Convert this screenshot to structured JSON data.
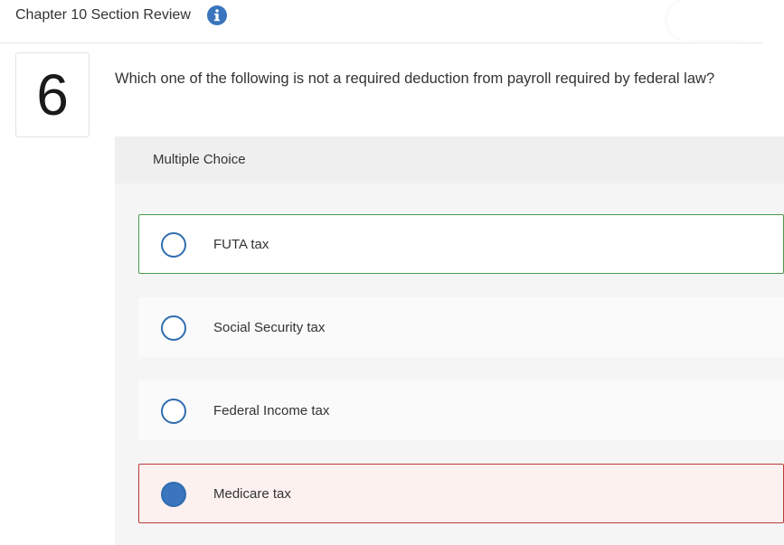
{
  "header": {
    "title": "Chapter 10 Section Review",
    "info_icon": "info-icon"
  },
  "question": {
    "number": "6",
    "text": "Which one of the following is not a required deduction from payroll required by federal law?",
    "type_label": "Multiple Choice"
  },
  "options": [
    {
      "label": "FUTA tax",
      "state": "correct",
      "selected": false
    },
    {
      "label": "Social Security tax",
      "state": "neutral",
      "selected": false
    },
    {
      "label": "Federal Income tax",
      "state": "neutral",
      "selected": false
    },
    {
      "label": "Medicare tax",
      "state": "incorrect",
      "selected": true
    }
  ],
  "colors": {
    "correct_border": "#4a9a4a",
    "incorrect_border": "#b83a3a",
    "radio_accent": "#2f6db0",
    "info_icon": "#3a75be"
  }
}
